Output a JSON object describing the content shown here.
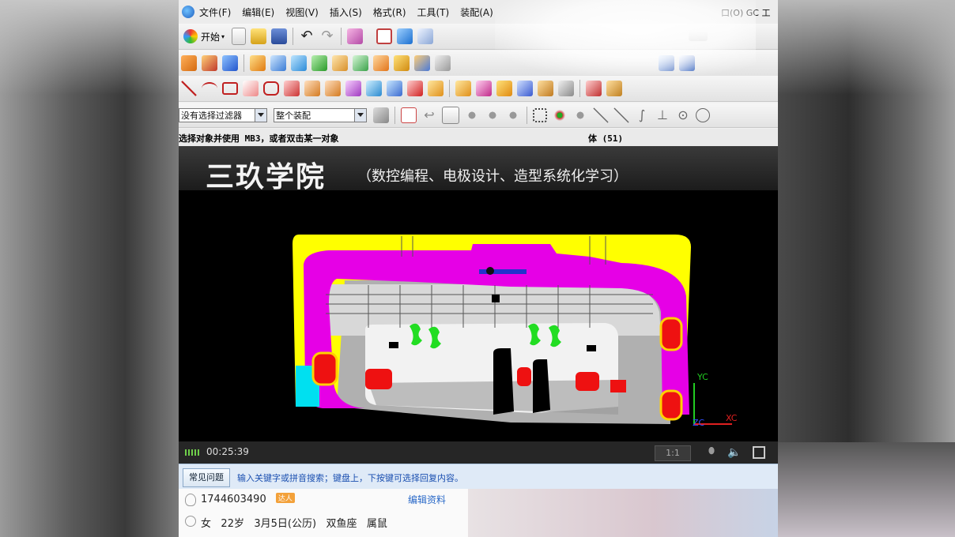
{
  "menu": {
    "items": [
      "文件(F)",
      "编辑(E)",
      "视图(V)",
      "插入(S)",
      "格式(R)",
      "工具(T)",
      "装配(A)"
    ],
    "right_items": "口(O)  GC 工"
  },
  "toolbar": {
    "start_label": "开始"
  },
  "selection_bar": {
    "filter_value": "没有选择过滤器",
    "scope_value": "整个装配"
  },
  "status": {
    "left_text": "选择对象并使用 MB3，或者双击某一对象",
    "right_text": "体 (51)"
  },
  "video": {
    "title": "三玖学院",
    "subtitle": "（数控编程、电极设计、造型系统化学习）",
    "axis_yc": "YC",
    "axis_xc": "XC",
    "axis_zc": "ZC"
  },
  "player": {
    "time": "00:25:39",
    "ratio": "1:1"
  },
  "chat": {
    "faq_label": "常见问题",
    "hint": "输入关键字或拼音搜索；键盘上，下按键可选择回复内容。"
  },
  "profile": {
    "qq": "1744603490",
    "badge": "达人",
    "edit_label": "编辑资料",
    "gender": "女",
    "age": "22岁",
    "birthday": "3月5日(公历)",
    "zodiac": "双鱼座",
    "animal": "属鼠"
  },
  "colors": {
    "magenta": "#e600e6",
    "yellow": "#ffff00",
    "green": "#22dd22",
    "red": "#ee1111",
    "cyan": "#00e0f0"
  }
}
